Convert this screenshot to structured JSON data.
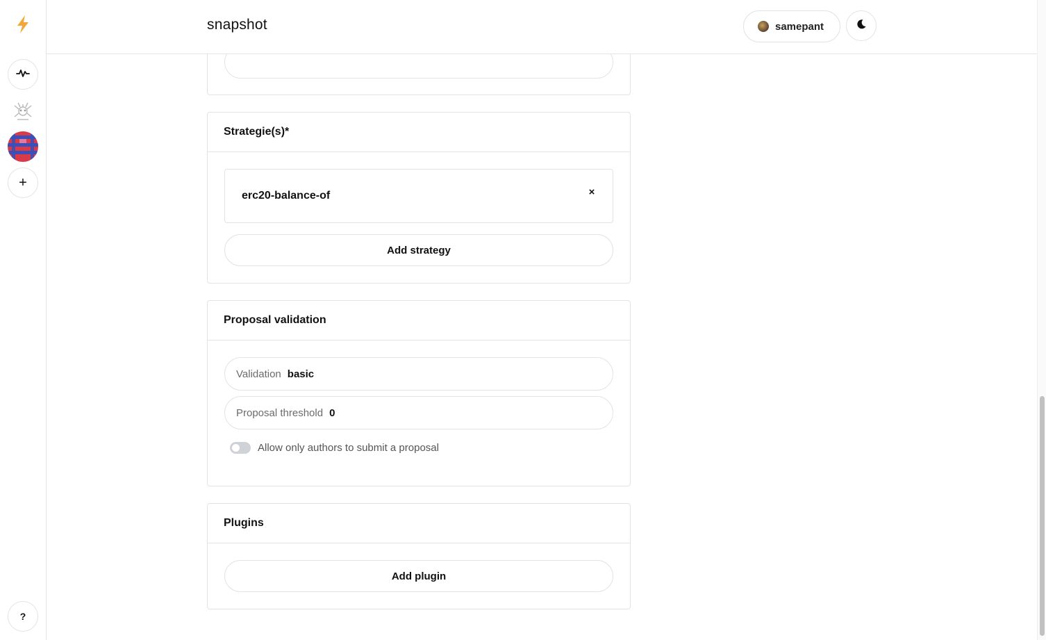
{
  "app": {
    "brand": "snapshot"
  },
  "header": {
    "username": "samepant",
    "theme_icon": "moon-icon"
  },
  "rail": {
    "logo_icon": "lightning-icon",
    "activity_icon": "activity-icon",
    "add_label": "+",
    "help_label": "?"
  },
  "strategies": {
    "title": "Strategie(s)*",
    "items": [
      {
        "name": "erc20-balance-of",
        "remove_label": "×"
      }
    ],
    "add_label": "Add strategy"
  },
  "validation": {
    "title": "Proposal validation",
    "validation_label": "Validation",
    "validation_value": "basic",
    "threshold_label": "Proposal threshold",
    "threshold_value": "0",
    "authors_only_label": "Allow only authors to submit a proposal",
    "authors_only_enabled": false
  },
  "plugins": {
    "title": "Plugins",
    "add_label": "Add plugin"
  },
  "colors": {
    "accent": "#f3a73a",
    "border": "#e3e3e3",
    "muted_text": "#6b6b6b",
    "toggle_off": "#cfd3d8"
  }
}
